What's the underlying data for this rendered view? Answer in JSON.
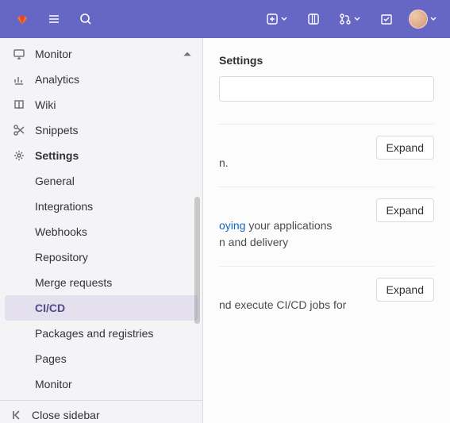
{
  "topbar": {
    "logo": "gitlab-logo",
    "left_icons": [
      {
        "name": "hamburger-icon"
      },
      {
        "name": "search-icon"
      }
    ],
    "right_icons": [
      {
        "name": "plus-icon",
        "dropdown": true
      },
      {
        "name": "issues-icon"
      },
      {
        "name": "merge-requests-icon",
        "dropdown": true
      },
      {
        "name": "todos-icon"
      }
    ],
    "avatar_alt": "User avatar"
  },
  "sidebar": {
    "top": [
      {
        "icon": "monitor",
        "label": "Monitor",
        "collapsible": true,
        "collapse_dir": "up"
      },
      {
        "icon": "analytics",
        "label": "Analytics"
      },
      {
        "icon": "wiki",
        "label": "Wiki"
      },
      {
        "icon": "snippets",
        "label": "Snippets"
      },
      {
        "icon": "settings",
        "label": "Settings",
        "bold": true
      }
    ],
    "settings_sub": [
      {
        "label": "General"
      },
      {
        "label": "Integrations"
      },
      {
        "label": "Webhooks"
      },
      {
        "label": "Repository"
      },
      {
        "label": "Merge requests"
      },
      {
        "label": "CI/CD",
        "active": true
      },
      {
        "label": "Packages and registries"
      },
      {
        "label": "Pages"
      },
      {
        "label": "Monitor"
      }
    ],
    "close_label": "Close sidebar"
  },
  "page": {
    "breadcrumb_tail": "Settings",
    "search_placeholder": "",
    "sections": [
      {
        "id": "general-pipelines",
        "expand_label": "Expand",
        "desc_suffix": "n."
      },
      {
        "id": "auto-devops",
        "expand_label": "Expand",
        "link_text": "oying",
        "desc_mid": " your applications",
        "desc_tail": "n and delivery"
      },
      {
        "id": "runners",
        "expand_label": "Expand",
        "desc_mid": "nd execute CI/CD jobs for"
      }
    ]
  }
}
